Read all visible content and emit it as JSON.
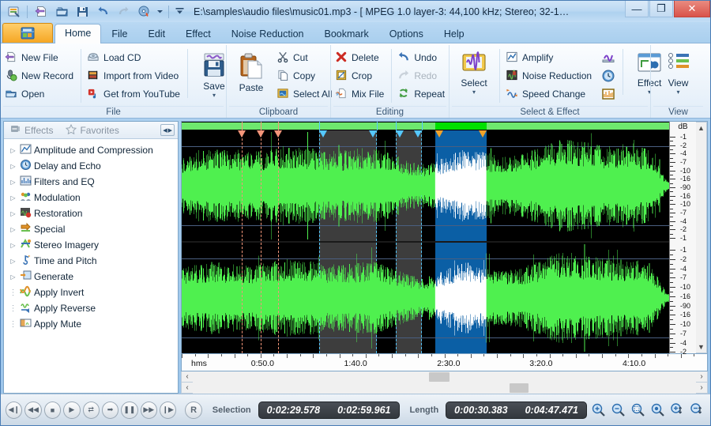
{
  "window": {
    "title": "E:\\samples\\audio files\\music01.mp3 - [ MPEG 1.0 layer-3: 44,100 kHz; Stereo; 32-1…",
    "minimize": "—",
    "maximize": "❐",
    "close": "✕"
  },
  "quick_access": {
    "items": [
      {
        "name": "app-icon",
        "icon": "application-icon"
      },
      {
        "name": "new-file",
        "icon": "new-file-icon"
      },
      {
        "name": "open",
        "icon": "open-folder-icon"
      },
      {
        "name": "save",
        "icon": "save-disk-icon"
      },
      {
        "name": "undo",
        "icon": "undo-arrow-icon"
      },
      {
        "name": "redo",
        "icon": "redo-arrow-icon"
      },
      {
        "name": "burn-cd",
        "icon": "burn-cd-icon"
      },
      {
        "name": "dropdown",
        "icon": "chevron-down-icon"
      },
      {
        "name": "customize",
        "icon": "customize-toolbar-icon"
      }
    ]
  },
  "tabs": [
    {
      "label": "Home",
      "active": true
    },
    {
      "label": "File",
      "active": false
    },
    {
      "label": "Edit",
      "active": false
    },
    {
      "label": "Effect",
      "active": false
    },
    {
      "label": "Noise Reduction",
      "active": false
    },
    {
      "label": "Bookmark",
      "active": false
    },
    {
      "label": "Options",
      "active": false
    },
    {
      "label": "Help",
      "active": false
    }
  ],
  "ribbon": {
    "groups": [
      {
        "title": "File",
        "col1": [
          {
            "label": "New File",
            "icon": "new-file-icon",
            "disabled": false
          },
          {
            "label": "New Record",
            "icon": "microphone-record-icon",
            "disabled": false
          },
          {
            "label": "Open",
            "icon": "open-folder-icon",
            "disabled": false
          }
        ],
        "col2": [
          {
            "label": "Load CD",
            "icon": "cd-drive-icon",
            "disabled": false
          },
          {
            "label": "Import from Video",
            "icon": "film-strip-icon",
            "disabled": false
          },
          {
            "label": "Get from YouTube",
            "icon": "youtube-icon",
            "disabled": false
          }
        ],
        "big": [
          {
            "label": "Save",
            "icon": "save-disk-icon",
            "caret": "▾"
          }
        ]
      },
      {
        "title": "Clipboard",
        "big": [
          {
            "label": "Paste",
            "icon": "clipboard-paste-icon",
            "caret": ""
          }
        ],
        "col1": [
          {
            "label": "Cut",
            "icon": "scissors-icon",
            "disabled": false
          },
          {
            "label": "Copy",
            "icon": "copy-pages-icon",
            "disabled": false
          },
          {
            "label": "Select All",
            "icon": "select-all-icon",
            "disabled": false
          }
        ]
      },
      {
        "title": "Editing",
        "col1": [
          {
            "label": "Delete",
            "icon": "red-x-delete-icon",
            "disabled": false
          },
          {
            "label": "Crop",
            "icon": "crop-icon",
            "disabled": false
          },
          {
            "label": "Mix File",
            "icon": "mix-file-icon",
            "disabled": false
          }
        ],
        "col2": [
          {
            "label": "Undo",
            "icon": "undo-arrow-icon",
            "disabled": false
          },
          {
            "label": "Redo",
            "icon": "redo-arrow-icon",
            "disabled": true
          },
          {
            "label": "Repeat",
            "icon": "repeat-arrows-icon",
            "disabled": false
          }
        ]
      },
      {
        "title": "Select & Effect",
        "big": [
          {
            "label": "Select",
            "icon": "select-waveform-icon",
            "caret": "▾"
          }
        ],
        "col1": [
          {
            "label": "Amplify",
            "icon": "amplify-chart-icon",
            "disabled": false
          },
          {
            "label": "Noise Reduction",
            "icon": "noise-reduction-icon",
            "disabled": false
          },
          {
            "label": "Speed Change",
            "icon": "speed-change-icon",
            "disabled": false
          }
        ],
        "iconcol": [
          {
            "name": "fade-icon"
          },
          {
            "name": "clock-delay-icon"
          },
          {
            "name": "equalizer-icon"
          }
        ],
        "big2": [
          {
            "label": "Effect",
            "icon": "effect-window-icon",
            "caret": "▾"
          }
        ]
      },
      {
        "title": "View",
        "big": [
          {
            "label": "View",
            "icon": "view-layout-icon",
            "caret": "▾"
          }
        ]
      }
    ]
  },
  "sidebar": {
    "tabs": [
      {
        "label": "Effects",
        "icon": "effects-icon"
      },
      {
        "label": "Favorites",
        "icon": "star-icon"
      }
    ],
    "nav_prev": "◀",
    "nav_next": "▶",
    "tree": [
      {
        "label": "Amplitude and Compression",
        "expandable": true,
        "icon": "amplitude-icon"
      },
      {
        "label": "Delay and Echo",
        "expandable": true,
        "icon": "delay-clock-icon"
      },
      {
        "label": "Filters and EQ",
        "expandable": true,
        "icon": "equalizer-icon"
      },
      {
        "label": "Modulation",
        "expandable": true,
        "icon": "modulation-people-icon"
      },
      {
        "label": "Restoration",
        "expandable": true,
        "icon": "restoration-icon"
      },
      {
        "label": "Special",
        "expandable": true,
        "icon": "special-arrow-icon"
      },
      {
        "label": "Stereo Imagery",
        "expandable": true,
        "icon": "stereo-imagery-icon"
      },
      {
        "label": "Time and Pitch",
        "expandable": true,
        "icon": "time-pitch-icon"
      },
      {
        "label": "Generate",
        "expandable": true,
        "icon": "generate-icon"
      },
      {
        "label": "Apply Invert",
        "expandable": false,
        "icon": "invert-icon"
      },
      {
        "label": "Apply Reverse",
        "expandable": false,
        "icon": "reverse-icon"
      },
      {
        "label": "Apply Mute",
        "expandable": false,
        "icon": "mute-icon"
      }
    ]
  },
  "editor": {
    "db_ruler_title": "dB",
    "db_ticks": [
      "-1",
      "-2",
      "-4",
      "-7",
      "-10",
      "-16",
      "-90",
      "-16",
      "-10",
      "-7",
      "-4",
      "-2",
      "-1"
    ],
    "time_unit": "hms",
    "time_labels": [
      {
        "text": "0:50.0",
        "pos_pct": 15.4
      },
      {
        "text": "1:40.0",
        "pos_pct": 33.1
      },
      {
        "text": "2:30.0",
        "pos_pct": 50.8
      },
      {
        "text": "3:20.0",
        "pos_pct": 68.4
      },
      {
        "text": "4:10.0",
        "pos_pct": 86.1
      }
    ],
    "regions": [
      {
        "type": "gray",
        "start_pct": 28.2,
        "end_pct": 40.1
      },
      {
        "type": "gray",
        "start_pct": 44.0,
        "end_pct": 49.2
      },
      {
        "type": "blue",
        "start_pct": 52.0,
        "end_pct": 62.5
      }
    ],
    "markers": [
      {
        "pos_pct": 12.3,
        "color": "#f4967a"
      },
      {
        "pos_pct": 16.2,
        "color": "#f4967a"
      },
      {
        "pos_pct": 19.8,
        "color": "#f4967a"
      }
    ],
    "colors": {
      "waveform": "#4ff04f",
      "waveform_selected": "#ffffff",
      "background": "#000000",
      "selection": "#0b5fa5",
      "marked_region": "#a0a0a0",
      "overview": "#6ee86e",
      "overview_selected": "#00e000"
    },
    "h_scroll_thumb_pct": 47,
    "h_scroll_thumb2_pct": 63,
    "scroll_left_arrow": "‹",
    "scroll_right_arrow": "›",
    "vscroll_up": "▲",
    "vscroll_down": "▼"
  },
  "status": {
    "transport": [
      {
        "name": "skip-to-start-button",
        "glyph": "◀❙"
      },
      {
        "name": "rewind-button",
        "glyph": "◀◀"
      },
      {
        "name": "stop-button",
        "glyph": "■"
      },
      {
        "name": "play-button",
        "glyph": "▶"
      },
      {
        "name": "loop-button",
        "glyph": "⇄"
      },
      {
        "name": "step-forward-button",
        "glyph": "➡"
      },
      {
        "name": "pause-button",
        "glyph": "❚❚"
      },
      {
        "name": "fast-forward-button",
        "glyph": "▶▶"
      },
      {
        "name": "skip-to-end-button",
        "glyph": "❙▶"
      }
    ],
    "record_label": "R",
    "selection_label": "Selection",
    "selection_start": "0:02:29.578",
    "selection_end": "0:02:59.961",
    "length_label": "Length",
    "length_selection": "0:00:30.383",
    "length_total": "0:04:47.471",
    "zoom_tools": [
      {
        "name": "zoom-in-button"
      },
      {
        "name": "zoom-out-button"
      },
      {
        "name": "zoom-to-selection-button"
      },
      {
        "name": "zoom-full-button"
      },
      {
        "name": "zoom-in-vertical-button"
      },
      {
        "name": "zoom-out-vertical-button"
      }
    ]
  }
}
